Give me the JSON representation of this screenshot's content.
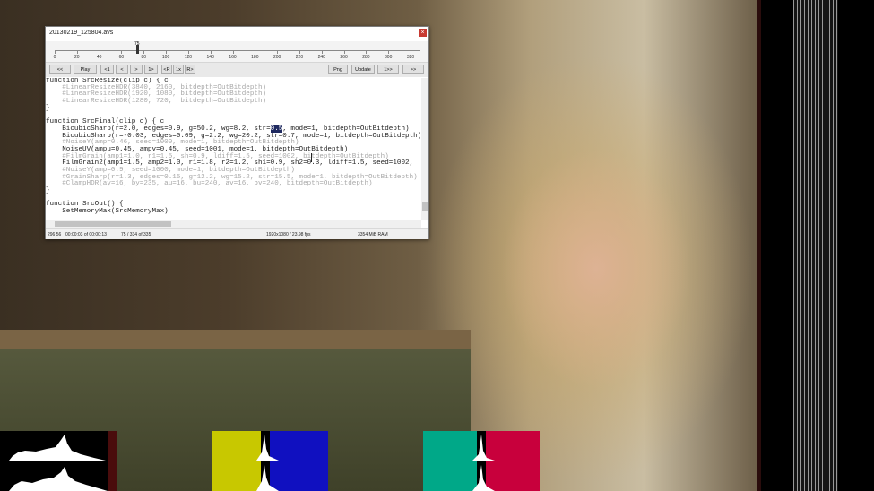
{
  "window": {
    "title": "20130219_125804.avs",
    "close_label": "×"
  },
  "timeline": {
    "current_frame": "75",
    "ticks": [
      "0",
      "20",
      "40",
      "60",
      "80",
      "100",
      "120",
      "140",
      "160",
      "180",
      "200",
      "220",
      "240",
      "260",
      "280",
      "300",
      "320"
    ]
  },
  "toolbar": {
    "first": "<<",
    "play": "Play",
    "prev_key": "<1",
    "prev": "<",
    "next": ">",
    "next_key": "1>",
    "rewind": "<R",
    "one_x": "1x",
    "fwd": "R>",
    "png": "Png",
    "update": "Update",
    "skip": "1>>",
    "last": ">>"
  },
  "code_lines": [
    {
      "t": "function SrcResize(clip c) { c",
      "c": false
    },
    {
      "t": "    #LinearResizeHDR(3840, 2160, bitdepth=OutBitdepth)",
      "c": true
    },
    {
      "t": "    #LinearResizeHDR(1920, 1080, bitdepth=OutBitdepth)",
      "c": true
    },
    {
      "t": "    #LinearResizeHDR(1280, 720,  bitdepth=OutBitdepth)",
      "c": true
    },
    {
      "t": "}",
      "c": false
    },
    {
      "t": "",
      "c": false
    },
    {
      "t": "function SrcFinal(clip c) { c",
      "c": false
    },
    {
      "t": "    BicubicSharp(r=2.0, edges=0.9, g=50.2, wg=8.2, str=0.5, mode=1, bitdepth=OutBitdepth)",
      "c": false
    },
    {
      "t": "    BicubicSharp(r=-0.03, edges=0.09, g=2.2, wg=20.2, str=0.7, mode=1, bitdepth=OutBitdepth)",
      "c": false
    },
    {
      "t": "    #NoiseY(amp=0.46, seed=1000, mode=1, bitdepth=OutBitdepth)",
      "c": true
    },
    {
      "t": "    NoiseUV(ampu=0.45, ampv=0.45, seed=1001, mode=1, bitdepth=OutBitdepth)",
      "c": false
    },
    {
      "t": "    #FilmGrain(amp1=1.0, r1=1.5, sh=0.9, ldiff=1.5, seed=1002, bitdepth=OutBitdepth)",
      "c": true
    },
    {
      "t": "    FilmGrain2(amp1=1.5, amp2=1.0, r1=1.8, r2=1.2, sh1=0.9, sh2=0.3, ldiff=1.5, seed=1002,",
      "c": false
    },
    {
      "t": "    #NoiseY(amp=0.9, seed=1000, mode=1, bitdepth=OutBitdepth)",
      "c": true
    },
    {
      "t": "    #GrainSharp(r=1.3, edges=0.15, g=12.2, wg=15.2, str=15.5, mode=1, bitdepth=OutBitdepth)",
      "c": true
    },
    {
      "t": "    #ClampHDR(ay=16, by=235, au=16, bu=240, av=16, bv=240, bitdepth=OutBitdepth)",
      "c": true
    },
    {
      "t": "}",
      "c": false
    },
    {
      "t": "",
      "c": false
    },
    {
      "t": "function SrcOut() {",
      "c": false
    },
    {
      "t": "    SetMemoryMax(SrcMemoryMax)",
      "c": false
    }
  ],
  "status": {
    "coords": "296 56",
    "time": "00:00:03 of 00:00:13",
    "frame": "75 / 334 of 335",
    "format": "1920x1080 / 23.98 fps",
    "memory": "3354 MiB RAM"
  },
  "colors": {
    "luma_hist_bg": "#000000",
    "hist_yellow": "#c8c800",
    "hist_blue": "#1010c0",
    "hist_teal": "#00a888",
    "hist_red": "#c8003c",
    "highlight": "#1f2a60"
  }
}
